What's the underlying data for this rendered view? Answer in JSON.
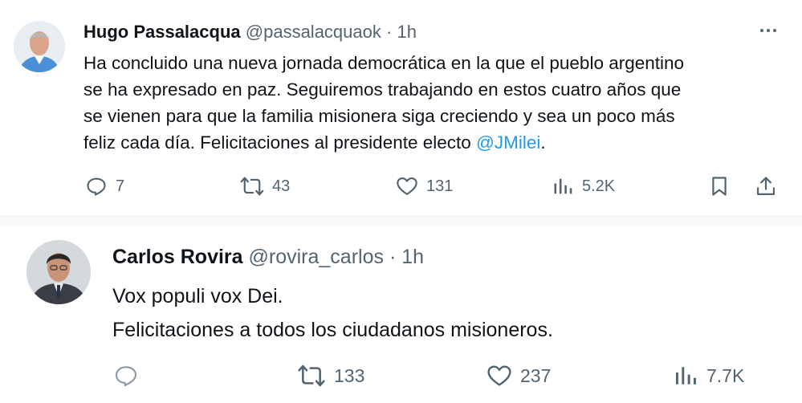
{
  "tweet1": {
    "name": "Hugo Passalacqua",
    "handle": "@passalacquaok",
    "sep": "·",
    "time": "1h",
    "more_icon": "more-horizontal-icon",
    "lines": [
      "Ha concluido una nueva jornada democrática en la que el pueblo argentino",
      "se ha expresado en paz. Seguiremos trabajando en estos cuatro años que",
      "se vienen para que la familia misionera siga creciendo y sea un poco más",
      "feliz cada día. Felicitaciones al presidente electo "
    ],
    "mention": "@JMilei",
    "mention_color": "#1d9bf0",
    "end": ".",
    "replies": "7",
    "retweets": "43",
    "likes": "131",
    "views": "5.2K"
  },
  "tweet2": {
    "name": "Carlos Rovira",
    "handle": "@rovira_carlos",
    "sep": "·",
    "time": "1h",
    "lines": [
      "Vox populi vox Dei.",
      "Felicitaciones a todos los ciudadanos misioneros."
    ],
    "retweets": "133",
    "likes": "237",
    "views": "7.7K"
  },
  "colors": {
    "text": "#0f1419",
    "secondary": "#536471",
    "divider": "#eff3f4"
  }
}
